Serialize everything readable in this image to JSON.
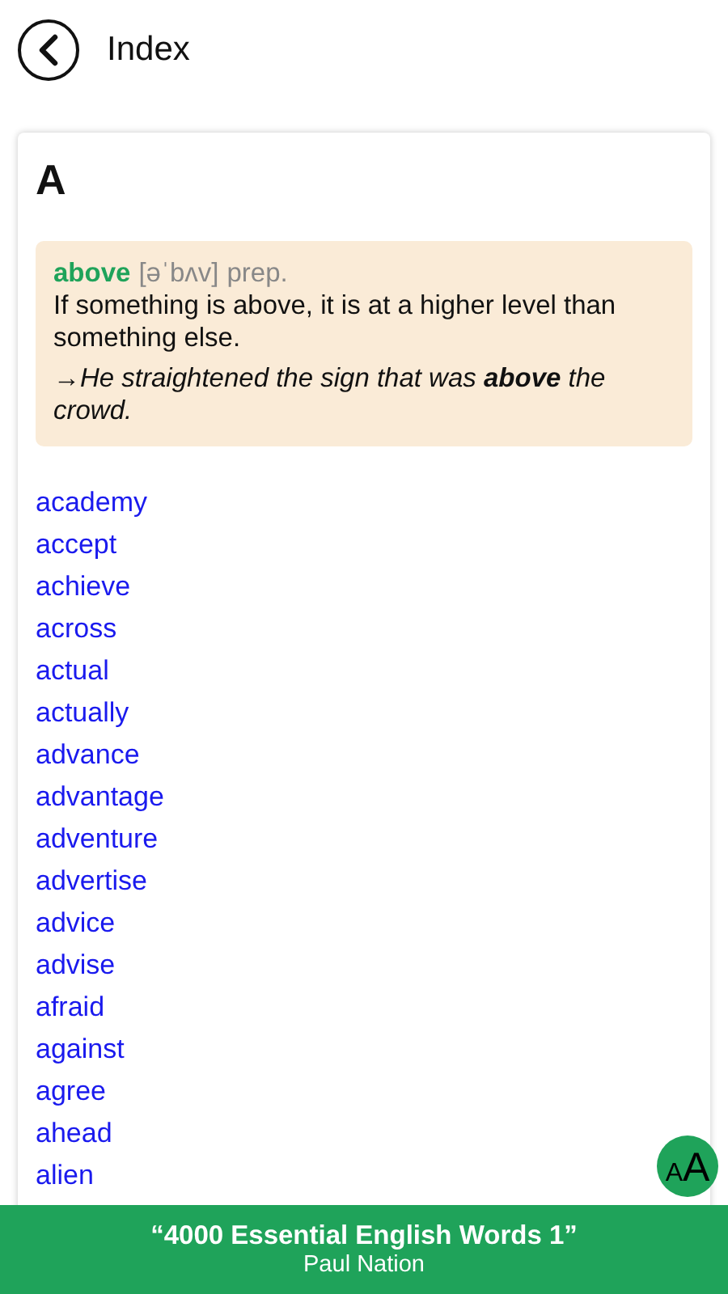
{
  "header": {
    "title": "Index"
  },
  "section": {
    "letter": "A",
    "featured": {
      "word": "above",
      "pronunciation": "[əˈbʌv]",
      "part_of_speech": "prep.",
      "definition": "If something is above, it is at a higher level than something else.",
      "example": "→He straightened the sign that was **above** the crowd."
    },
    "words": [
      "academy",
      "accept",
      "achieve",
      "across",
      "actual",
      "actually",
      "advance",
      "advantage",
      "adventure",
      "advertise",
      "advice",
      "advise",
      "afraid",
      "against",
      "agree",
      "ahead",
      "alien"
    ]
  },
  "font_button": {
    "small": "A",
    "large": "A"
  },
  "footer": {
    "title": "“4000 Essential English Words 1”",
    "author": "Paul Nation"
  }
}
